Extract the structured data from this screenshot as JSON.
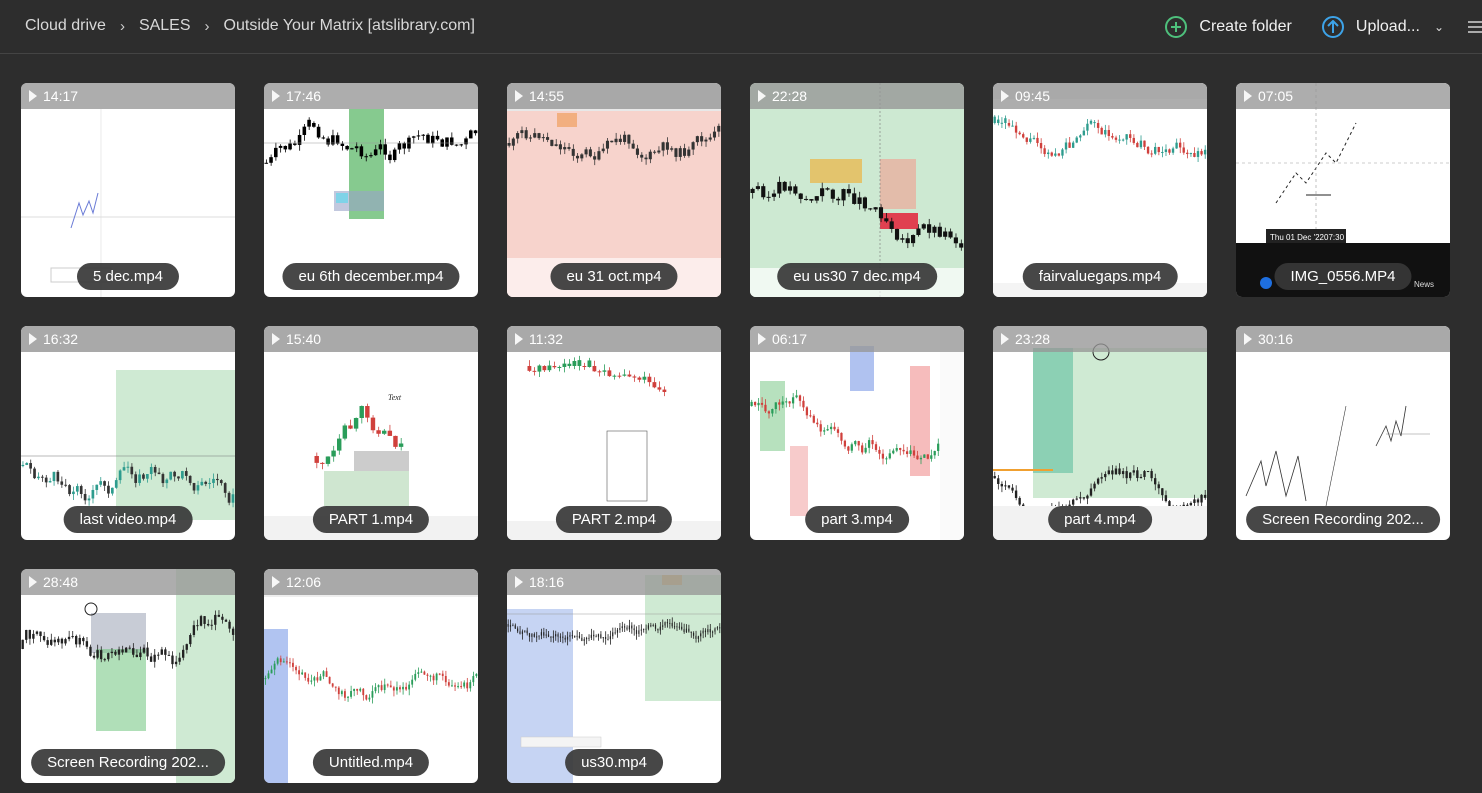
{
  "breadcrumb": [
    "Cloud drive",
    "SALES",
    "Outside Your Matrix [atslibrary.com]"
  ],
  "breadcrumb_separator": "›",
  "toolbar": {
    "create_folder": "Create folder",
    "upload": "Upload..."
  },
  "files": [
    {
      "duration": "14:17",
      "name": "5 dec.mp4"
    },
    {
      "duration": "17:46",
      "name": "eu 6th december.mp4"
    },
    {
      "duration": "14:55",
      "name": "eu 31 oct.mp4"
    },
    {
      "duration": "22:28",
      "name": "eu us30 7 dec.mp4"
    },
    {
      "duration": "09:45",
      "name": "fairvaluegaps.mp4"
    },
    {
      "duration": "07:05",
      "name": "IMG_0556.MP4"
    },
    {
      "duration": "16:32",
      "name": "last video.mp4"
    },
    {
      "duration": "15:40",
      "name": "PART 1.mp4"
    },
    {
      "duration": "11:32",
      "name": "PART 2.mp4"
    },
    {
      "duration": "06:17",
      "name": "part 3.mp4"
    },
    {
      "duration": "23:28",
      "name": "part 4.mp4"
    },
    {
      "duration": "30:16",
      "name": "Screen Recording 202..."
    },
    {
      "duration": "28:48",
      "name": "Screen Recording 202..."
    },
    {
      "duration": "12:06",
      "name": "Untitled.mp4"
    },
    {
      "duration": "18:16",
      "name": "us30.mp4"
    }
  ],
  "thumbnail_text": {
    "img_date": "Thu 01 Dec '22",
    "img_time": "07:30",
    "img_news": "News",
    "part1_text": "Text"
  }
}
